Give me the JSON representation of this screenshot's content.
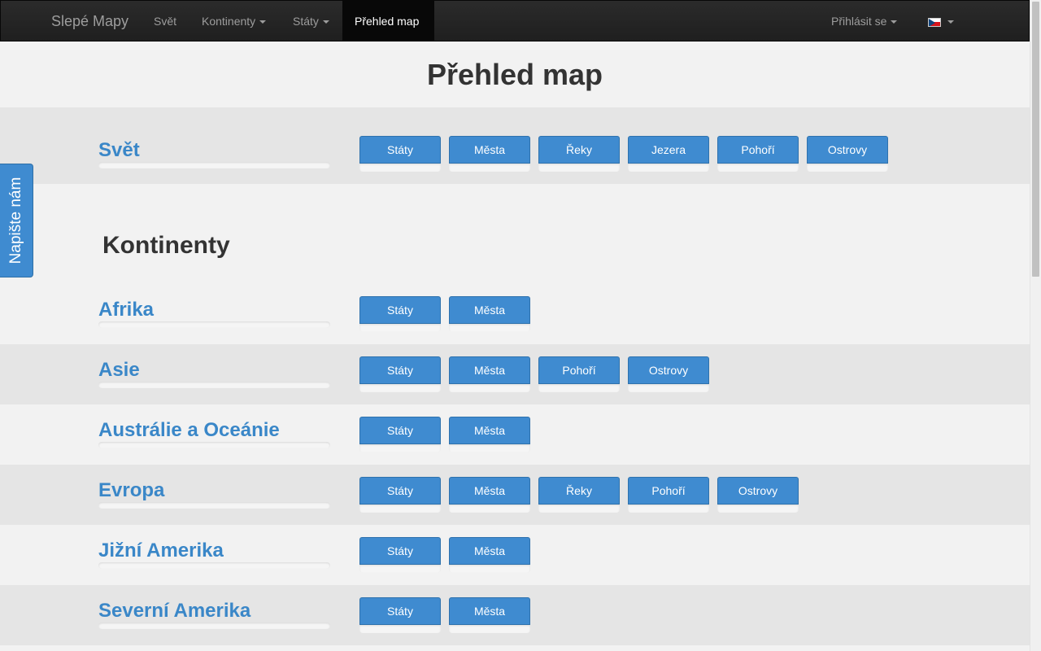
{
  "navbar": {
    "brand": "Slepé Mapy",
    "items": [
      {
        "label": "Svět",
        "dropdown": false,
        "active": false
      },
      {
        "label": "Kontinenty",
        "dropdown": true,
        "active": false
      },
      {
        "label": "Státy",
        "dropdown": true,
        "active": false
      },
      {
        "label": "Přehled map",
        "dropdown": false,
        "active": true
      }
    ],
    "login_label": "Přihlásit se",
    "language_flag": "czech-flag-icon"
  },
  "page": {
    "title": "Přehled map",
    "section_title": "Kontinenty"
  },
  "feedback": {
    "label": "Napište nám"
  },
  "world": {
    "name": "Svět",
    "buttons": [
      "Státy",
      "Města",
      "Řeky",
      "Jezera",
      "Pohoří",
      "Ostrovy"
    ]
  },
  "continents": [
    {
      "name": "Afrika",
      "buttons": [
        "Státy",
        "Města"
      ]
    },
    {
      "name": "Asie",
      "buttons": [
        "Státy",
        "Města",
        "Pohoří",
        "Ostrovy"
      ]
    },
    {
      "name": "Austrálie a Oceánie",
      "buttons": [
        "Státy",
        "Města"
      ]
    },
    {
      "name": "Evropa",
      "buttons": [
        "Státy",
        "Města",
        "Řeky",
        "Pohoří",
        "Ostrovy"
      ]
    },
    {
      "name": "Jižní Amerika",
      "buttons": [
        "Státy",
        "Města"
      ]
    },
    {
      "name": "Severní Amerika",
      "buttons": [
        "Státy",
        "Města"
      ]
    }
  ],
  "colors": {
    "accent": "#3f8bd0",
    "link": "#3a87c8",
    "navbar": "#222222",
    "row_dark": "#e5e5e5",
    "row_light": "#f2f2f2"
  }
}
